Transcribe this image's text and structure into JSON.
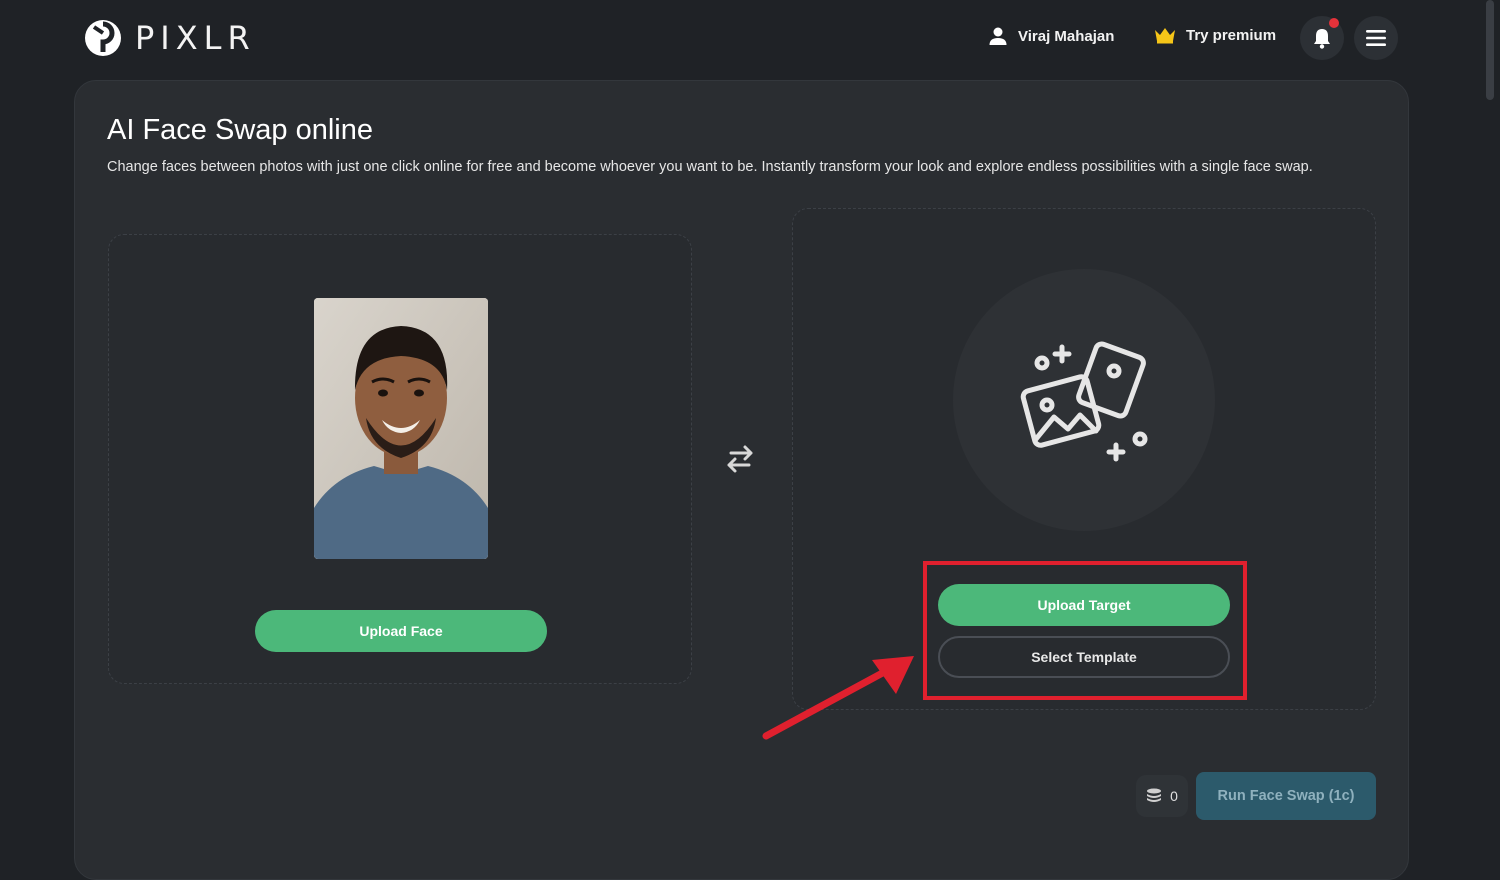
{
  "header": {
    "logo_text": "PIXLR",
    "user_name": "Viraj Mahajan",
    "premium_label": "Try premium"
  },
  "main": {
    "title": "AI Face Swap online",
    "description": "Change faces between photos with just one click online for free and become whoever you want to be. Instantly transform your look and explore endless possibilities with a single face swap.",
    "upload_face_label": "Upload Face",
    "upload_target_label": "Upload Target",
    "select_template_label": "Select Template",
    "credits_count": "0",
    "run_button_label": "Run Face Swap (1c)"
  },
  "colors": {
    "accent_green": "#4cb87a",
    "highlight_red": "#e0202e",
    "background": "#1f2226",
    "card": "#2a2d31"
  }
}
